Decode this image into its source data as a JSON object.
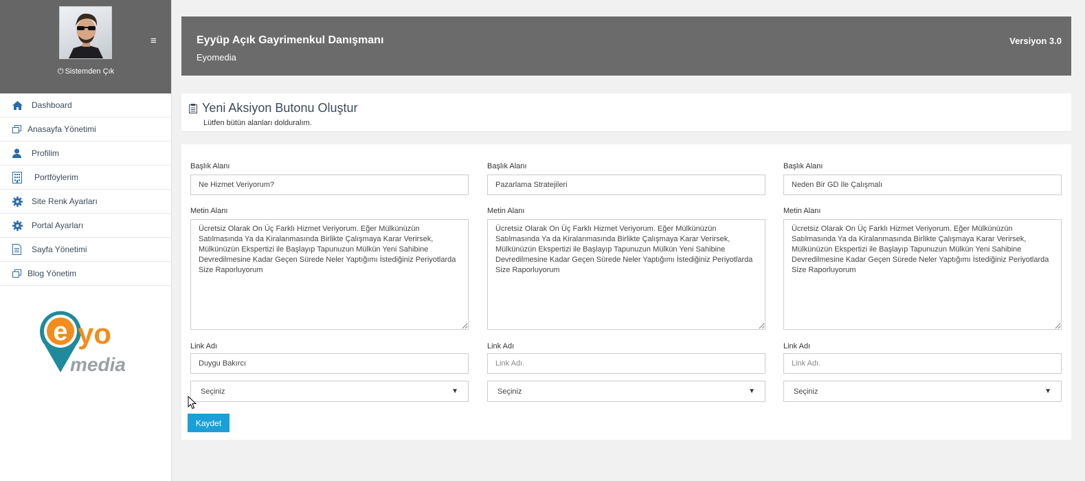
{
  "sidebar": {
    "logout_label": "Sistemden Çık",
    "items": [
      {
        "label": "Dashboard",
        "icon": "home-icon"
      },
      {
        "label": "Anasayfa Yönetimi",
        "icon": "copy-icon"
      },
      {
        "label": "Profilim",
        "icon": "user-icon"
      },
      {
        "label": "Portföylerim",
        "icon": "building-icon"
      },
      {
        "label": "Site Renk Ayarları",
        "icon": "gear-icon"
      },
      {
        "label": "Portal Ayarları",
        "icon": "gear-icon"
      },
      {
        "label": "Sayfa Yönetimi",
        "icon": "file-icon"
      },
      {
        "label": "Blog Yönetim",
        "icon": "copy-icon"
      }
    ],
    "logo_text_1": "yo",
    "logo_text_2": "media"
  },
  "header": {
    "title": "Eyyüp Açık Gayrimenkul Danışmanı",
    "subtitle": "Eyomedia",
    "version": "Versiyon 3.0"
  },
  "page": {
    "title": "Yeni Aksiyon Butonu Oluştur",
    "subtitle": "Lütfen bütün alanları dolduralım."
  },
  "form": {
    "columns": [
      {
        "title_label": "Başlık Alanı",
        "title_value": "Ne Hizmet Veriyorum?",
        "text_label": "Metin Alanı",
        "text_value": "Ücretsiz Olarak On Üç Farklı Hizmet Veriyorum. Eğer Mülkünüzün Satılmasında Ya da Kiralanmasında Birlikte Çalışmaya Karar Verirsek, Mülkünüzün Ekspertizi ile Başlayıp Tapunuzun Mülkün Yeni Sahibine Devredilmesine Kadar Geçen Sürede Neler Yaptığımı İstediğiniz Periyotlarda Size Raporluyorum",
        "link_label": "Link Adı",
        "link_value": "Duygu Bakırcı",
        "link_placeholder": "Link Adı.",
        "select_value": "Seçiniz"
      },
      {
        "title_label": "Başlık Alanı",
        "title_value": "Pazarlama Stratejileri",
        "text_label": "Metin Alanı",
        "text_value": "Ücretsiz Olarak On Üç Farklı Hizmet Veriyorum. Eğer Mülkünüzün Satılmasında Ya da Kiralanmasında Birlikte Çalışmaya Karar Verirsek, Mülkünüzün Ekspertizi ile Başlayıp Tapunuzun Mülkün Yeni Sahibine Devredilmesine Kadar Geçen Sürede Neler Yaptığımı İstediğiniz Periyotlarda Size Raporluyorum",
        "link_label": "Link Adı",
        "link_value": "",
        "link_placeholder": "Link Adı.",
        "select_value": "Seçiniz"
      },
      {
        "title_label": "Başlık Alanı",
        "title_value": "Neden Bir GD İle Çalışmalı",
        "text_label": "Metin Alanı",
        "text_value": "Ücretsiz Olarak On Üç Farklı Hizmet Veriyorum. Eğer Mülkünüzün Satılmasında Ya da Kiralanmasında Birlikte Çalışmaya Karar Verirsek, Mülkünüzün Ekspertizi ile Başlayıp Tapunuzun Mülkün Yeni Sahibine Devredilmesine Kadar Geçen Sürede Neler Yaptığımı İstediğiniz Periyotlarda Size Raporluyorum",
        "link_label": "Link Adı",
        "link_value": "",
        "link_placeholder": "Link Adı.",
        "select_value": "Seçiniz"
      }
    ],
    "save_label": "Kaydet"
  },
  "colors": {
    "sidebar_top": "#666666",
    "header_bg": "#6b6b6b",
    "accent": "#1a9fd9",
    "icon_blue": "#2a6ca8",
    "logo_orange": "#f28c1c",
    "logo_teal": "#1f8a9c"
  }
}
